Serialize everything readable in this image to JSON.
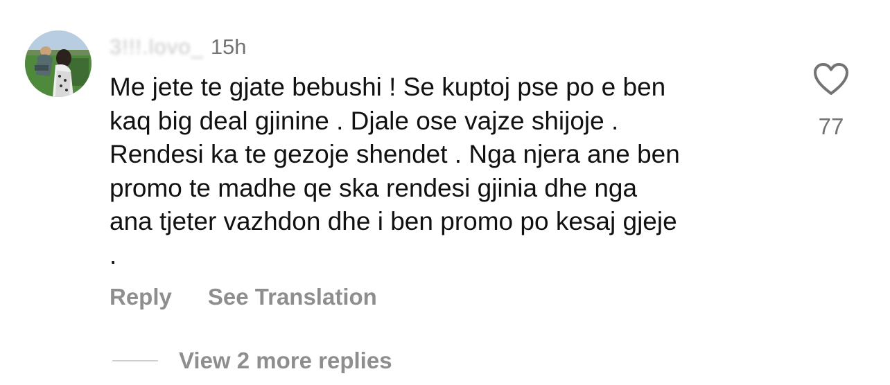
{
  "comment": {
    "username": "3!!!.lovo_",
    "timestamp": "15h",
    "text_lines": [
      "Me jete te gjate bebushi ! Se kuptoj pse po e ben",
      "kaq big deal gjinine . Djale ose vajze shijoje .",
      "Rendesi ka te gezoje shendet . Nga njera ane ben",
      "promo te madhe qe ska rendesi gjinia dhe nga",
      "ana tjeter vazhdon dhe i ben promo po kesaj gjeje",
      "."
    ],
    "like_count": "77",
    "like_icon": "heart-outline-icon"
  },
  "actions": {
    "reply_label": "Reply",
    "translate_label": "See Translation"
  },
  "replies": {
    "more_label": "View 2 more replies"
  },
  "colors": {
    "text_primary": "#111111",
    "text_secondary": "#737373",
    "action_text": "#8e8e8e",
    "divider": "#cfcfcf"
  }
}
